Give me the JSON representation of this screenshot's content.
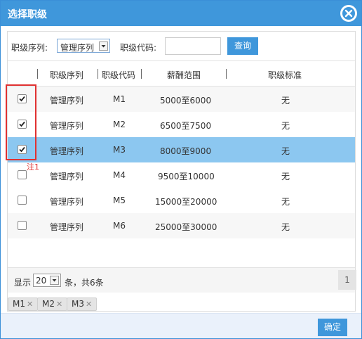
{
  "dialog": {
    "title": "选择职级"
  },
  "filter": {
    "series_label": "职级序列:",
    "series_value": "管理序列",
    "code_label": "职级代码:",
    "code_value": "",
    "query_label": "查询"
  },
  "table": {
    "headers": [
      "职级序列",
      "职级代码",
      "薪酬范围",
      "职级标准"
    ],
    "rows": [
      {
        "checked": true,
        "series": "管理序列",
        "code": "M1",
        "salary": "5000至6000",
        "standard": "无"
      },
      {
        "checked": true,
        "series": "管理序列",
        "code": "M2",
        "salary": "6500至7500",
        "standard": "无"
      },
      {
        "checked": true,
        "series": "管理序列",
        "code": "M3",
        "salary": "8000至9000",
        "standard": "无"
      },
      {
        "checked": false,
        "series": "管理序列",
        "code": "M4",
        "salary": "9500至10000",
        "standard": "无"
      },
      {
        "checked": false,
        "series": "管理序列",
        "code": "M5",
        "salary": "15000至20000",
        "standard": "无"
      },
      {
        "checked": false,
        "series": "管理序列",
        "code": "M6",
        "salary": "25000至30000",
        "standard": "无"
      }
    ]
  },
  "annotation": {
    "note": "注1"
  },
  "pager": {
    "show_label": "显示",
    "page_size": "20",
    "summary": "条，共6条",
    "current_page": "1"
  },
  "selected_tags": [
    "M1",
    "M2",
    "M3"
  ],
  "actions": {
    "confirm_label": "确定"
  },
  "colors": {
    "accent": "#3f97db",
    "selected_row": "#8cc7f0",
    "annotation": "#e03131"
  }
}
